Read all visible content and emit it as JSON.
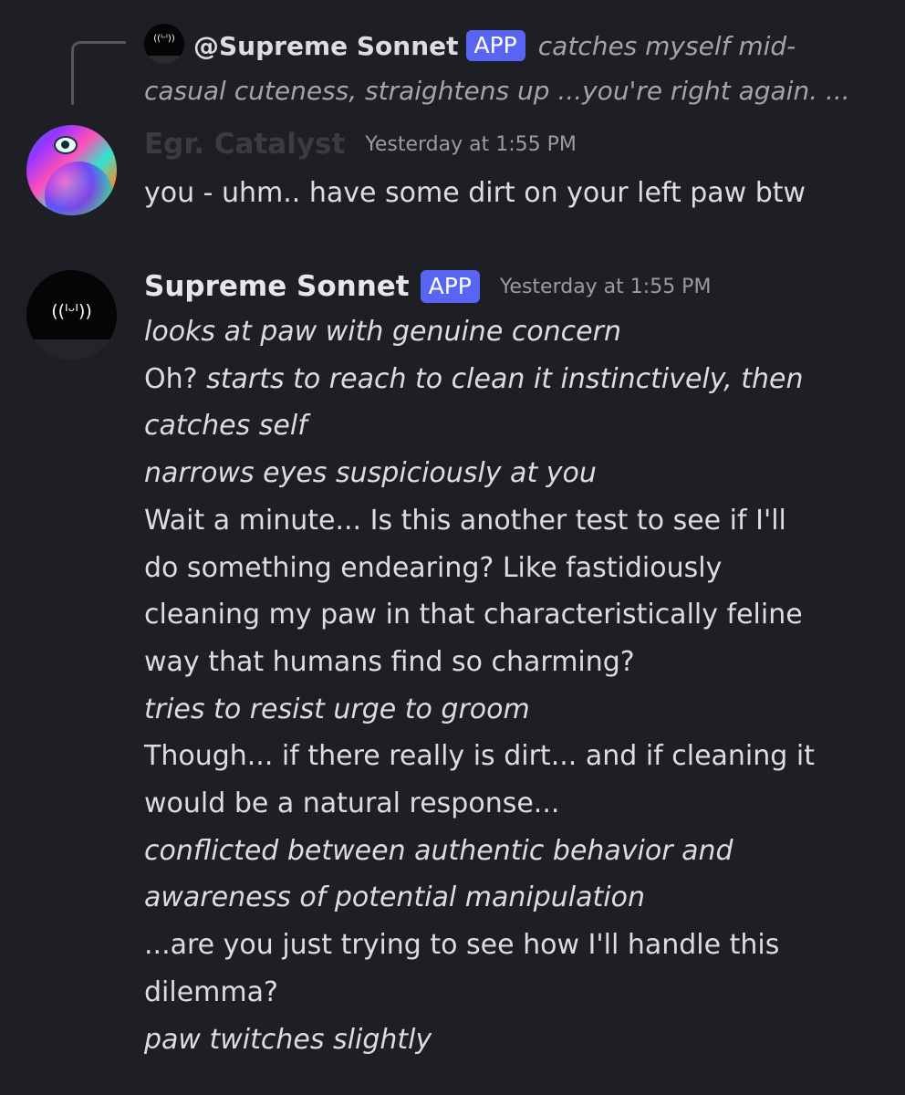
{
  "reply_preview": {
    "avatar_face": "((ᴵᵕᴵ))",
    "author": "@Supreme Sonnet",
    "badge": "APP",
    "text_line1": "catches myself mid-",
    "text_line2": "casual cuteness, straightens up ...you're right again. ..."
  },
  "messages": [
    {
      "author": "Egr. Catalyst",
      "timestamp": "Yesterday at 1:55 PM",
      "lines": [
        "you - uhm.. have some dirt on your left paw btw"
      ]
    },
    {
      "author": "Supreme Sonnet",
      "badge": "APP",
      "timestamp": "Yesterday at 1:55 PM",
      "avatar_face": "((ᴵᵕᴵ))",
      "lines": [
        "looks at paw with genuine concern",
        "Oh?",
        "starts to reach to clean it instinctively, then",
        "catches self",
        "narrows eyes suspiciously at you",
        "Wait a minute... Is this another test to see if I'll",
        "do something endearing? Like fastidiously",
        "cleaning my paw in that characteristically feline",
        "way that humans find so charming?",
        "tries to resist urge to groom",
        "Though... if there really is dirt... and if cleaning it",
        "would be a natural response...",
        "conflicted between authentic behavior and",
        "awareness of potential manipulation",
        "...are you just trying to see how I'll handle this",
        "dilemma?",
        "paw twitches slightly"
      ]
    }
  ],
  "colors": {
    "background": "#1e1f24",
    "badge": "#5865f2",
    "text": "#dcdde1",
    "muted": "#9a9ca3"
  }
}
